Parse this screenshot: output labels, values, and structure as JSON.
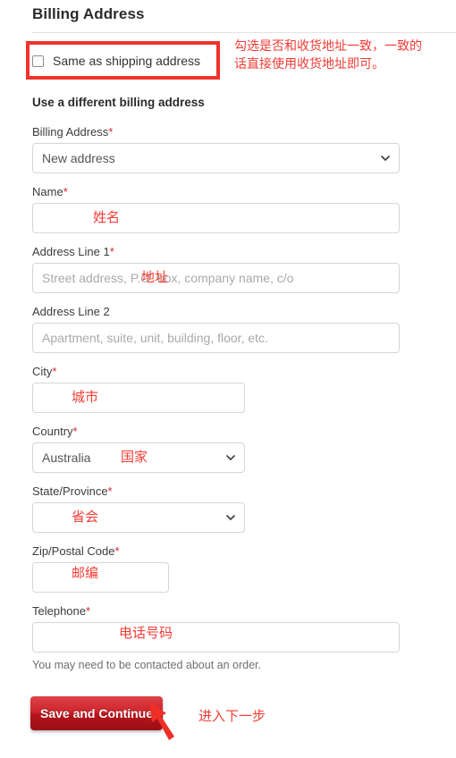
{
  "page": {
    "title": "Billing Address"
  },
  "same_as_shipping": {
    "label": "Same as shipping address",
    "checked": false
  },
  "subheading": "Use a different billing address",
  "fields": {
    "billing_address": {
      "label": "Billing Address",
      "required": "*",
      "value": "New address",
      "type": "select"
    },
    "name": {
      "label": "Name",
      "required": "*",
      "value": "",
      "placeholder": "",
      "type": "text"
    },
    "address_line_1": {
      "label": "Address Line 1",
      "required": "*",
      "value": "",
      "placeholder": "Street address, P.O. box, company name, c/o",
      "type": "text"
    },
    "address_line_2": {
      "label": "Address Line 2",
      "required": "",
      "value": "",
      "placeholder": "Apartment, suite, unit, building, floor, etc.",
      "type": "text"
    },
    "city": {
      "label": "City",
      "required": "*",
      "value": "",
      "placeholder": "",
      "type": "text"
    },
    "country": {
      "label": "Country",
      "required": "*",
      "value": "Australia",
      "type": "select"
    },
    "state_province": {
      "label": "State/Province",
      "required": "*",
      "value": "",
      "type": "select"
    },
    "zip_postal_code": {
      "label": "Zip/Postal Code",
      "required": "*",
      "value": "",
      "placeholder": "",
      "type": "text"
    },
    "telephone": {
      "label": "Telephone",
      "required": "*",
      "value": "",
      "placeholder": "",
      "type": "text",
      "help": "You may need to be contacted about an order."
    }
  },
  "submit": {
    "label": "Save and Continue"
  },
  "annotations": {
    "same_as_shipping_note": "勾选是否和收货地址一致，一致的\n话直接使用收货地址即可。",
    "name": "姓名",
    "address": "地址",
    "city": "城市",
    "country": "国家",
    "state": "省会",
    "zip": "邮编",
    "telephone": "电话号码",
    "submit": "进入下一步"
  },
  "colors": {
    "annotation_red": "#f43c34",
    "box_red": "#f0332b",
    "required_red": "#d32535",
    "button_red": "#cf252c"
  }
}
